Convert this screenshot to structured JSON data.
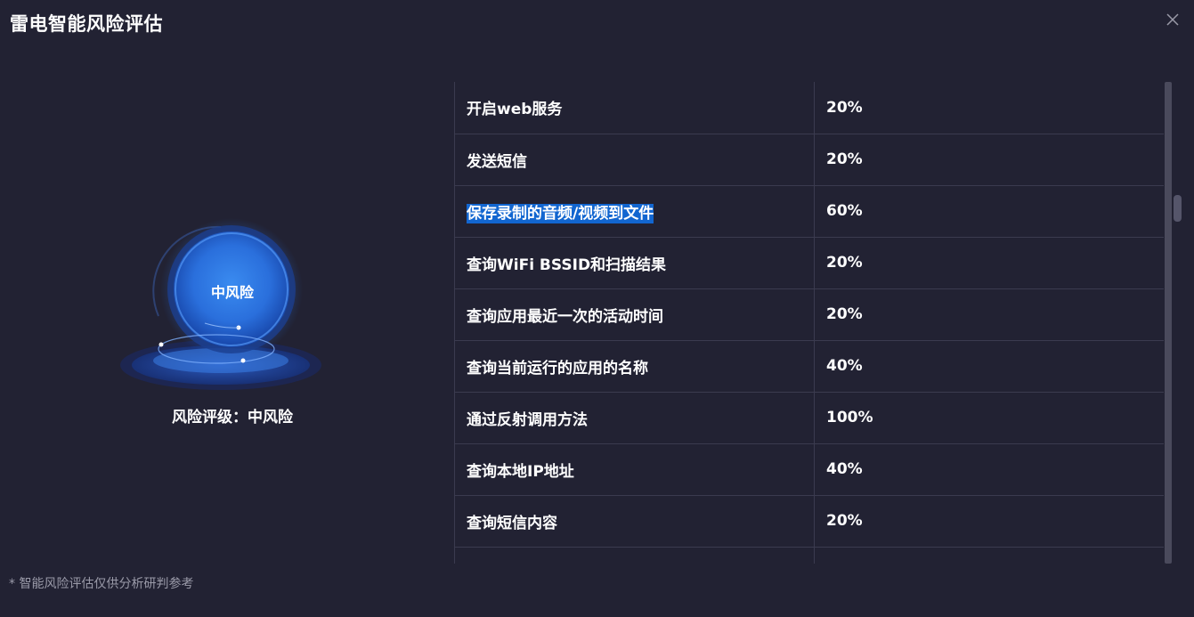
{
  "dialog": {
    "title": "雷电智能风险评估",
    "close_icon": "close-icon"
  },
  "risk": {
    "level_center": "中风险",
    "level_label": "风险评级：中风险",
    "colors": {
      "orb_core": "#2f7de6",
      "orb_edge": "#1b4fb0",
      "ring": "#1d3f8a"
    }
  },
  "table": {
    "rows": [
      {
        "name": "开启web服务",
        "percent": "20%"
      },
      {
        "name": "发送短信",
        "percent": "20%"
      },
      {
        "name": "保存录制的音频/视频到文件",
        "percent": "60%",
        "highlighted": true
      },
      {
        "name": "查询WiFi BSSID和扫描结果",
        "percent": "20%"
      },
      {
        "name": "查询应用最近一次的活动时间",
        "percent": "20%"
      },
      {
        "name": "查询当前运行的应用的名称",
        "percent": "40%"
      },
      {
        "name": "通过反射调用方法",
        "percent": "100%"
      },
      {
        "name": "查询本地IP地址",
        "percent": "40%"
      },
      {
        "name": "查询短信内容",
        "percent": "20%"
      },
      {
        "name": "",
        "percent": ""
      }
    ]
  },
  "footnote": "* 智能风险评估仅供分析研判参考",
  "colors": {
    "background": "#222233",
    "highlight": "#1266d0",
    "border": "#3b3b4f"
  }
}
